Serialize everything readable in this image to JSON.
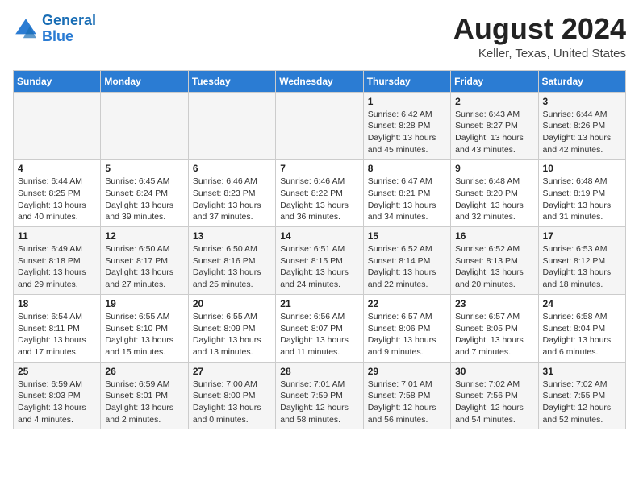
{
  "header": {
    "logo_line1": "General",
    "logo_line2": "Blue",
    "month_year": "August 2024",
    "location": "Keller, Texas, United States"
  },
  "weekdays": [
    "Sunday",
    "Monday",
    "Tuesday",
    "Wednesday",
    "Thursday",
    "Friday",
    "Saturday"
  ],
  "weeks": [
    [
      {
        "day": "",
        "info": ""
      },
      {
        "day": "",
        "info": ""
      },
      {
        "day": "",
        "info": ""
      },
      {
        "day": "",
        "info": ""
      },
      {
        "day": "1",
        "info": "Sunrise: 6:42 AM\nSunset: 8:28 PM\nDaylight: 13 hours\nand 45 minutes."
      },
      {
        "day": "2",
        "info": "Sunrise: 6:43 AM\nSunset: 8:27 PM\nDaylight: 13 hours\nand 43 minutes."
      },
      {
        "day": "3",
        "info": "Sunrise: 6:44 AM\nSunset: 8:26 PM\nDaylight: 13 hours\nand 42 minutes."
      }
    ],
    [
      {
        "day": "4",
        "info": "Sunrise: 6:44 AM\nSunset: 8:25 PM\nDaylight: 13 hours\nand 40 minutes."
      },
      {
        "day": "5",
        "info": "Sunrise: 6:45 AM\nSunset: 8:24 PM\nDaylight: 13 hours\nand 39 minutes."
      },
      {
        "day": "6",
        "info": "Sunrise: 6:46 AM\nSunset: 8:23 PM\nDaylight: 13 hours\nand 37 minutes."
      },
      {
        "day": "7",
        "info": "Sunrise: 6:46 AM\nSunset: 8:22 PM\nDaylight: 13 hours\nand 36 minutes."
      },
      {
        "day": "8",
        "info": "Sunrise: 6:47 AM\nSunset: 8:21 PM\nDaylight: 13 hours\nand 34 minutes."
      },
      {
        "day": "9",
        "info": "Sunrise: 6:48 AM\nSunset: 8:20 PM\nDaylight: 13 hours\nand 32 minutes."
      },
      {
        "day": "10",
        "info": "Sunrise: 6:48 AM\nSunset: 8:19 PM\nDaylight: 13 hours\nand 31 minutes."
      }
    ],
    [
      {
        "day": "11",
        "info": "Sunrise: 6:49 AM\nSunset: 8:18 PM\nDaylight: 13 hours\nand 29 minutes."
      },
      {
        "day": "12",
        "info": "Sunrise: 6:50 AM\nSunset: 8:17 PM\nDaylight: 13 hours\nand 27 minutes."
      },
      {
        "day": "13",
        "info": "Sunrise: 6:50 AM\nSunset: 8:16 PM\nDaylight: 13 hours\nand 25 minutes."
      },
      {
        "day": "14",
        "info": "Sunrise: 6:51 AM\nSunset: 8:15 PM\nDaylight: 13 hours\nand 24 minutes."
      },
      {
        "day": "15",
        "info": "Sunrise: 6:52 AM\nSunset: 8:14 PM\nDaylight: 13 hours\nand 22 minutes."
      },
      {
        "day": "16",
        "info": "Sunrise: 6:52 AM\nSunset: 8:13 PM\nDaylight: 13 hours\nand 20 minutes."
      },
      {
        "day": "17",
        "info": "Sunrise: 6:53 AM\nSunset: 8:12 PM\nDaylight: 13 hours\nand 18 minutes."
      }
    ],
    [
      {
        "day": "18",
        "info": "Sunrise: 6:54 AM\nSunset: 8:11 PM\nDaylight: 13 hours\nand 17 minutes."
      },
      {
        "day": "19",
        "info": "Sunrise: 6:55 AM\nSunset: 8:10 PM\nDaylight: 13 hours\nand 15 minutes."
      },
      {
        "day": "20",
        "info": "Sunrise: 6:55 AM\nSunset: 8:09 PM\nDaylight: 13 hours\nand 13 minutes."
      },
      {
        "day": "21",
        "info": "Sunrise: 6:56 AM\nSunset: 8:07 PM\nDaylight: 13 hours\nand 11 minutes."
      },
      {
        "day": "22",
        "info": "Sunrise: 6:57 AM\nSunset: 8:06 PM\nDaylight: 13 hours\nand 9 minutes."
      },
      {
        "day": "23",
        "info": "Sunrise: 6:57 AM\nSunset: 8:05 PM\nDaylight: 13 hours\nand 7 minutes."
      },
      {
        "day": "24",
        "info": "Sunrise: 6:58 AM\nSunset: 8:04 PM\nDaylight: 13 hours\nand 6 minutes."
      }
    ],
    [
      {
        "day": "25",
        "info": "Sunrise: 6:59 AM\nSunset: 8:03 PM\nDaylight: 13 hours\nand 4 minutes."
      },
      {
        "day": "26",
        "info": "Sunrise: 6:59 AM\nSunset: 8:01 PM\nDaylight: 13 hours\nand 2 minutes."
      },
      {
        "day": "27",
        "info": "Sunrise: 7:00 AM\nSunset: 8:00 PM\nDaylight: 13 hours\nand 0 minutes."
      },
      {
        "day": "28",
        "info": "Sunrise: 7:01 AM\nSunset: 7:59 PM\nDaylight: 12 hours\nand 58 minutes."
      },
      {
        "day": "29",
        "info": "Sunrise: 7:01 AM\nSunset: 7:58 PM\nDaylight: 12 hours\nand 56 minutes."
      },
      {
        "day": "30",
        "info": "Sunrise: 7:02 AM\nSunset: 7:56 PM\nDaylight: 12 hours\nand 54 minutes."
      },
      {
        "day": "31",
        "info": "Sunrise: 7:02 AM\nSunset: 7:55 PM\nDaylight: 12 hours\nand 52 minutes."
      }
    ]
  ]
}
